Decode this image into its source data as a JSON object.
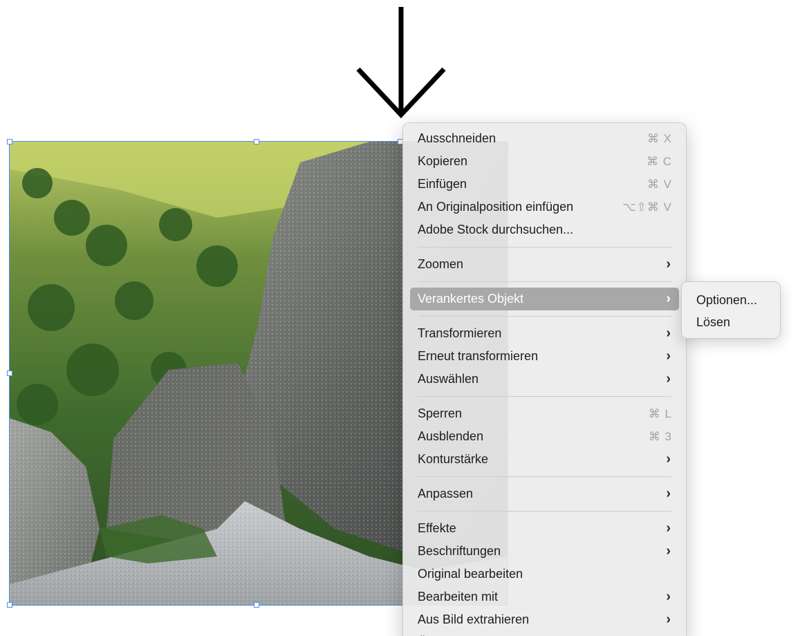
{
  "canvas": {
    "image_description_icon": "arrow-down-icon"
  },
  "context_menu": {
    "groups": [
      [
        {
          "label": "Ausschneiden",
          "shortcut": "⌘ X"
        },
        {
          "label": "Kopieren",
          "shortcut": "⌘ C"
        },
        {
          "label": "Einfügen",
          "shortcut": "⌘ V"
        },
        {
          "label": "An Originalposition einfügen",
          "shortcut": "⌥⇧⌘ V"
        },
        {
          "label": "Adobe Stock durchsuchen..."
        }
      ],
      [
        {
          "label": "Zoomen",
          "submenu": true
        }
      ],
      [
        {
          "label": "Verankertes Objekt",
          "submenu": true,
          "highlighted": true
        }
      ],
      [
        {
          "label": "Transformieren",
          "submenu": true
        },
        {
          "label": "Erneut transformieren",
          "submenu": true
        },
        {
          "label": "Auswählen",
          "submenu": true
        }
      ],
      [
        {
          "label": "Sperren",
          "shortcut": "⌘ L"
        },
        {
          "label": "Ausblenden",
          "shortcut": "⌘ 3"
        },
        {
          "label": "Konturstärke",
          "submenu": true
        }
      ],
      [
        {
          "label": "Anpassen",
          "submenu": true
        }
      ],
      [
        {
          "label": "Effekte",
          "submenu": true
        },
        {
          "label": "Beschriftungen",
          "submenu": true
        },
        {
          "label": "Original bearbeiten"
        },
        {
          "label": "Bearbeiten mit",
          "submenu": true
        },
        {
          "label": "Aus Bild extrahieren",
          "submenu": true
        },
        {
          "label": "Ö"
        }
      ]
    ],
    "chevron": "›"
  },
  "submenu": {
    "items": [
      {
        "label": "Optionen..."
      },
      {
        "label": "Lösen"
      }
    ]
  },
  "colors": {
    "selection": "#4a90e2",
    "highlight": "#a8a8a8"
  }
}
